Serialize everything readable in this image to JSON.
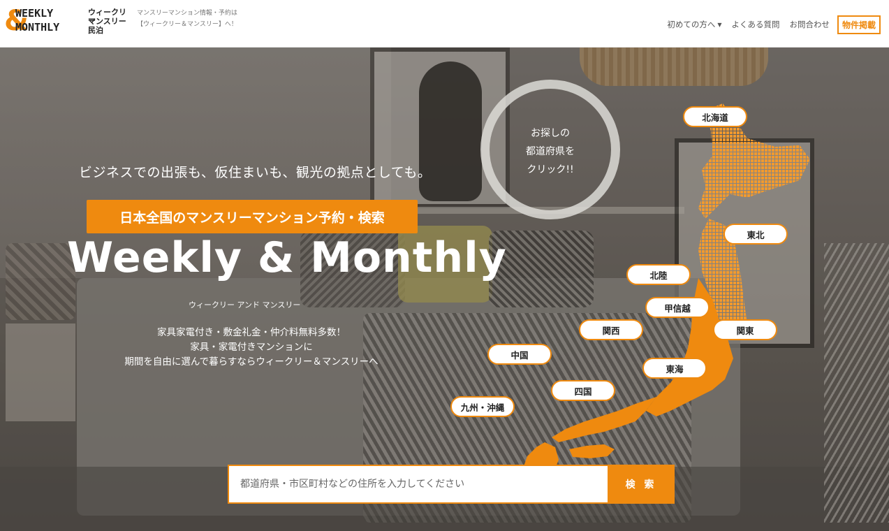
{
  "header": {
    "logo": {
      "word1": "WEEKLY",
      "word2": "MONTHLY",
      "jp1": "ウィークリー",
      "jp2": "マンスリー",
      "jp3": "民泊"
    },
    "tagline_line1": "マンスリーマンション情報・予約は",
    "tagline_line2": "【ウィークリー＆マンスリー】へ！",
    "nav": {
      "first_time": "初めての方へ",
      "faq": "よくある質問",
      "contact": "お問合わせ",
      "post_property": "物件掲載"
    }
  },
  "hero": {
    "sub_catch": "ビジネスでの出張も、仮住まいも、観光の拠点としても。",
    "banner": "日本全国のマンスリーマンション予約・検索",
    "title": "Weekly & Monthly",
    "title_kana": "ウィークリー アンド マンスリー",
    "desc_line1": "家具家電付き・敷金礼金・仲介料無料多数！",
    "desc_line2": "家具・家電付きマンションに",
    "desc_line3": "期間を自由に選んで暮らすならウィークリー＆マンスリーへ",
    "circle_line1": "お探しの",
    "circle_line2": "都道府県を",
    "circle_line3": "クリック!!"
  },
  "regions": {
    "hokkaido": "北海道",
    "tohoku": "東北",
    "hokuriku": "北陸",
    "koshinetsu": "甲信越",
    "kanto": "関東",
    "kansai": "関西",
    "tokai": "東海",
    "chugoku": "中国",
    "shikoku": "四国",
    "kyushu": "九州・沖縄"
  },
  "search": {
    "placeholder": "都道府県・市区町村などの住所を入力してください",
    "button": "検 索"
  },
  "colors": {
    "accent": "#ef8a0f"
  }
}
